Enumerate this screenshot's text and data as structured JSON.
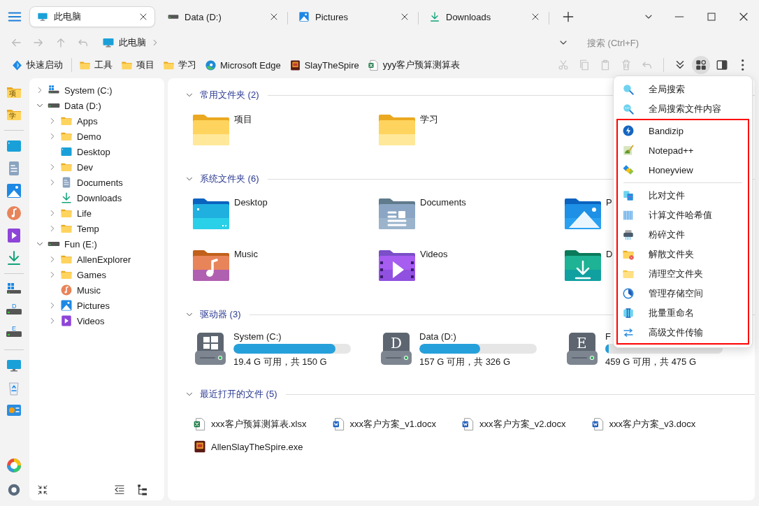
{
  "tabs": [
    {
      "label": "此电脑",
      "kind": "computer",
      "selected": true
    },
    {
      "label": "Data (D:)",
      "kind": "drive",
      "selected": false
    },
    {
      "label": "Pictures",
      "kind": "pictures",
      "selected": false
    },
    {
      "label": "Downloads",
      "kind": "downloads",
      "selected": false
    }
  ],
  "address": {
    "breadcrumb": [
      {
        "label": "此电脑",
        "kind": "computer"
      }
    ],
    "search": {
      "placeholder": "搜索 (Ctrl+F)"
    }
  },
  "bookmarks": [
    {
      "label": "快速启动",
      "kind": "launch"
    },
    {
      "label": "工具",
      "kind": "folder"
    },
    {
      "label": "项目",
      "kind": "folder"
    },
    {
      "label": "学习",
      "kind": "folder"
    },
    {
      "label": "Microsoft Edge",
      "kind": "edge"
    },
    {
      "label": "SlayTheSpire",
      "kind": "game"
    },
    {
      "label": "yyy客户预算测算表",
      "kind": "excel"
    }
  ],
  "toolbar": [
    [
      {
        "kind": "cut",
        "disabled": true,
        "pressed": false
      },
      {
        "kind": "copy",
        "disabled": true,
        "pressed": false
      },
      {
        "kind": "paste",
        "disabled": true,
        "pressed": false
      },
      {
        "kind": "delete",
        "disabled": true,
        "pressed": false
      },
      {
        "kind": "undo",
        "disabled": true,
        "pressed": false
      }
    ],
    [
      {
        "kind": "expand",
        "disabled": false,
        "pressed": false
      },
      {
        "kind": "apps",
        "disabled": false,
        "pressed": true
      },
      {
        "kind": "panel",
        "disabled": false,
        "pressed": false
      },
      {
        "kind": "more",
        "disabled": false,
        "pressed": false
      }
    ]
  ],
  "rail": [
    {
      "kind": "folder",
      "label": "项"
    },
    {
      "kind": "folder",
      "label": "学"
    },
    {
      "kind": "separator"
    },
    {
      "kind": "desktop"
    },
    {
      "kind": "documents"
    },
    {
      "kind": "pictures"
    },
    {
      "kind": "music"
    },
    {
      "kind": "videos"
    },
    {
      "kind": "downloads"
    },
    {
      "kind": "separator"
    },
    {
      "kind": "sysdrive"
    },
    {
      "kind": "drive",
      "label": "D"
    },
    {
      "kind": "drive",
      "label": "E"
    },
    {
      "kind": "separator"
    },
    {
      "kind": "computer"
    },
    {
      "kind": "recycle"
    },
    {
      "kind": "control"
    }
  ],
  "tree": [
    {
      "label": "System (C:)",
      "kind": "sysdrive",
      "expandable": true,
      "expanded": false
    },
    {
      "label": "Data (D:)",
      "kind": "drive",
      "expandable": true,
      "expanded": true,
      "children": [
        {
          "label": "Apps",
          "kind": "folder",
          "expandable": true,
          "expanded": false
        },
        {
          "label": "Demo",
          "kind": "folder",
          "expandable": true,
          "expanded": false
        },
        {
          "label": "Desktop",
          "kind": "desktop",
          "expandable": false
        },
        {
          "label": "Dev",
          "kind": "folder",
          "expandable": true,
          "expanded": false
        },
        {
          "label": "Documents",
          "kind": "documents",
          "expandable": true,
          "expanded": false
        },
        {
          "label": "Downloads",
          "kind": "downloads",
          "expandable": false
        },
        {
          "label": "Life",
          "kind": "folder",
          "expandable": true,
          "expanded": false
        },
        {
          "label": "Temp",
          "kind": "folder",
          "expandable": true,
          "expanded": false
        }
      ]
    },
    {
      "label": "Fun (E:)",
      "kind": "drive",
      "expandable": true,
      "expanded": true,
      "children": [
        {
          "label": "AllenExplorer",
          "kind": "folder",
          "expandable": true,
          "expanded": false
        },
        {
          "label": "Games",
          "kind": "folder",
          "expandable": true,
          "expanded": false
        },
        {
          "label": "Music",
          "kind": "music",
          "expandable": false
        },
        {
          "label": "Pictures",
          "kind": "pictures",
          "expandable": true,
          "expanded": false
        },
        {
          "label": "Videos",
          "kind": "videos",
          "expandable": true,
          "expanded": false
        }
      ]
    }
  ],
  "sections": [
    {
      "title": "常用文件夹 (2)",
      "kind": "folders",
      "expanded": true,
      "items": [
        {
          "label": "项目",
          "kind": "folder"
        },
        {
          "label": "学习",
          "kind": "folder"
        }
      ]
    },
    {
      "title": "系统文件夹 (6)",
      "kind": "folders",
      "expanded": true,
      "items": [
        {
          "label": "Desktop",
          "kind": "desktop"
        },
        {
          "label": "Documents",
          "kind": "documents"
        },
        {
          "label": "P",
          "kind": "pictures"
        },
        {
          "label": "Music",
          "kind": "music"
        },
        {
          "label": "Videos",
          "kind": "videos"
        },
        {
          "label": "D",
          "kind": "downloads"
        }
      ]
    },
    {
      "title": "驱动器 (3)",
      "kind": "drives",
      "expanded": true,
      "items": [
        {
          "label": "System (C:)",
          "kind": "sysdrive",
          "level": 0.87,
          "usage": "19.4 G 可用，共 150 G"
        },
        {
          "label": "Data (D:)",
          "kind": "drive",
          "letter": "D",
          "level": 0.52,
          "usage": "157 G 可用，共 326 G"
        },
        {
          "label": "F",
          "kind": "drive",
          "letter": "E",
          "level": 0.03,
          "usage": "459 G 可用，共 475 G"
        }
      ]
    },
    {
      "title": "最近打开的文件 (5)",
      "kind": "files",
      "expanded": true,
      "items": [
        {
          "label": "xxx客户预算测算表.xlsx",
          "kind": "excel"
        },
        {
          "label": "xxx客户方案_v1.docx",
          "kind": "word"
        },
        {
          "label": "xxx客户方案_v2.docx",
          "kind": "word"
        },
        {
          "label": "xxx客户方案_v3.docx",
          "kind": "word"
        },
        {
          "label": "AllenSlayTheSpire.exe",
          "kind": "game"
        }
      ]
    }
  ],
  "menu": {
    "sections": [
      {
        "highlighted": false,
        "groups": [
          [
            {
              "label": "全局搜索",
              "kind": "search"
            },
            {
              "label": "全局搜索文件内容",
              "kind": "search-content"
            }
          ]
        ]
      },
      {
        "highlighted": true,
        "groups": [
          [
            {
              "label": "Bandizip",
              "kind": "bandizip"
            },
            {
              "label": "Notepad++",
              "kind": "notepad"
            },
            {
              "label": "Honeyview",
              "kind": "honeyview"
            }
          ],
          [
            {
              "label": "比对文件",
              "kind": "compare"
            },
            {
              "label": "计算文件哈希值",
              "kind": "hash"
            },
            {
              "label": "粉碎文件",
              "kind": "shred"
            },
            {
              "label": "解散文件夹",
              "kind": "unpack"
            },
            {
              "label": "清理空文件夹",
              "kind": "clean"
            },
            {
              "label": "管理存储空间",
              "kind": "storage"
            },
            {
              "label": "批量重命名",
              "kind": "rename"
            },
            {
              "label": "高级文件传输",
              "kind": "transfer"
            }
          ]
        ]
      }
    ]
  }
}
